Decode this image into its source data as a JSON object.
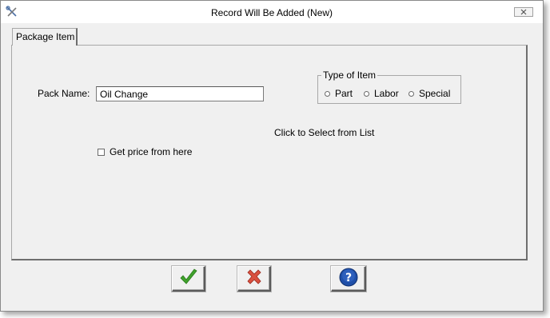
{
  "window": {
    "title": "Record Will Be Added  (New)"
  },
  "tabs": [
    {
      "label": "Package Item"
    }
  ],
  "form": {
    "pack_name_label": "Pack Name:",
    "pack_name_value": "Oil Change",
    "type_group": {
      "legend": "Type of Item",
      "options": [
        {
          "label": "Part"
        },
        {
          "label": "Labor"
        },
        {
          "label": "Special"
        }
      ]
    },
    "select_list_text": "Click to Select from List",
    "get_price_label": "Get price from here",
    "get_price_checked": false
  },
  "buttons": {
    "ok_icon": "checkmark-icon",
    "cancel_icon": "x-icon",
    "help_icon": "help-icon"
  },
  "colors": {
    "ok_green": "#3fa12b",
    "cancel_red": "#c0392b",
    "help_blue": "#1f4fa8"
  }
}
